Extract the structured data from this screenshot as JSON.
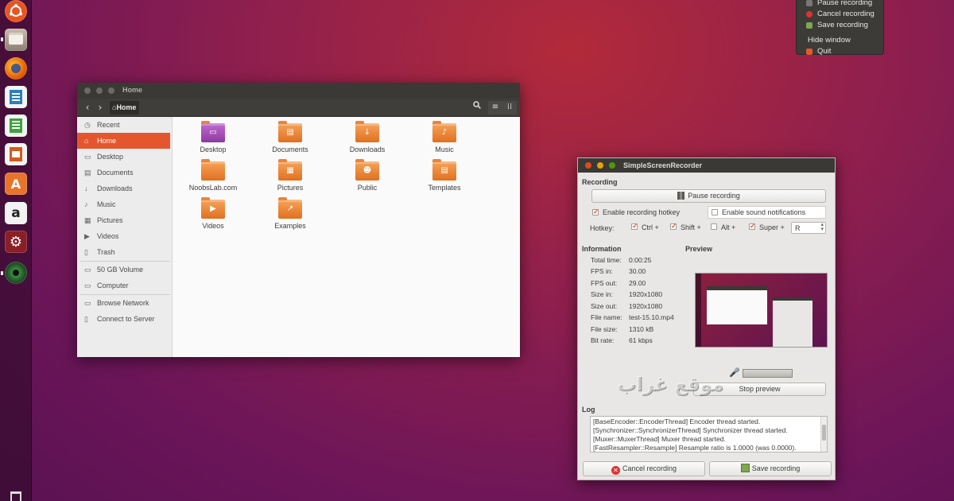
{
  "launcher": {
    "items": [
      {
        "name": "ubuntu-dash-icon",
        "color": "#e95420"
      },
      {
        "name": "files-icon",
        "color": "#9b8d7e"
      },
      {
        "name": "firefox-icon",
        "color": "#e66000"
      },
      {
        "name": "libreoffice-writer-icon",
        "color": "#2a7fbd"
      },
      {
        "name": "libreoffice-calc-icon",
        "color": "#3aa53a"
      },
      {
        "name": "libreoffice-impress-icon",
        "color": "#d55a1e"
      },
      {
        "name": "ubuntu-software-icon",
        "color": "#e8742a"
      },
      {
        "name": "amazon-icon",
        "color": "#f2f2f2"
      },
      {
        "name": "system-settings-icon",
        "color": "#c0392b"
      },
      {
        "name": "simplescreenrecorder-icon",
        "color": "#2f6f3a"
      },
      {
        "name": "trash-icon",
        "color": "#8c8c8c"
      }
    ]
  },
  "tray_menu": {
    "items": [
      "Pause recording",
      "Cancel recording",
      "Save recording",
      "Hide window",
      "Quit"
    ]
  },
  "nautilus": {
    "window_title": "Home",
    "breadcrumb": "Home",
    "sidebar": [
      {
        "label": "Recent",
        "icon": "clock-icon",
        "glyph": "◷"
      },
      {
        "label": "Home",
        "icon": "home-icon",
        "glyph": "⌂",
        "active": true
      },
      {
        "label": "Desktop",
        "icon": "desktop-icon",
        "glyph": "▭"
      },
      {
        "label": "Documents",
        "icon": "document-icon",
        "glyph": "▤"
      },
      {
        "label": "Downloads",
        "icon": "download-icon",
        "glyph": "↓"
      },
      {
        "label": "Music",
        "icon": "music-icon",
        "glyph": "♪"
      },
      {
        "label": "Pictures",
        "icon": "picture-icon",
        "glyph": "▦"
      },
      {
        "label": "Videos",
        "icon": "video-icon",
        "glyph": "▶"
      },
      {
        "label": "Trash",
        "icon": "trash-icon",
        "glyph": "▯"
      },
      {
        "label": "50 GB Volume",
        "icon": "drive-icon",
        "glyph": "▭"
      },
      {
        "label": "Computer",
        "icon": "computer-icon",
        "glyph": "▭"
      },
      {
        "label": "Browse Network",
        "icon": "network-icon",
        "glyph": "▭"
      },
      {
        "label": "Connect to Server",
        "icon": "server-icon",
        "glyph": "▯"
      }
    ],
    "folders": [
      {
        "label": "Desktop",
        "glyph": "▭",
        "color": "#9c4dab"
      },
      {
        "label": "Documents",
        "glyph": "▤",
        "color": "#e8742a"
      },
      {
        "label": "Downloads",
        "glyph": "↓",
        "color": "#e8742a"
      },
      {
        "label": "Music",
        "glyph": "♪",
        "color": "#e8742a"
      },
      {
        "label": "NoobsLab.com",
        "glyph": "",
        "color": "#e8742a"
      },
      {
        "label": "Pictures",
        "glyph": "▦",
        "color": "#e8742a"
      },
      {
        "label": "Public",
        "glyph": "☻",
        "color": "#e8742a"
      },
      {
        "label": "Templates",
        "glyph": "▤",
        "color": "#e8742a"
      },
      {
        "label": "Videos",
        "glyph": "▶",
        "color": "#e8742a"
      },
      {
        "label": "Examples",
        "glyph": "↗",
        "color": "#e8742a"
      }
    ]
  },
  "ssr": {
    "window_title": "SimpleScreenRecorder",
    "recording_heading": "Recording",
    "pause_button": "Pause recording",
    "enable_hotkey": "Enable recording hotkey",
    "enable_sound": "Enable sound notifications",
    "hotkey_label": "Hotkey:",
    "mod_ctrl": "Ctrl +",
    "mod_shift": "Shift +",
    "mod_alt": "Alt +",
    "mod_super": "Super +",
    "hotkey_key": "R",
    "information_heading": "Information",
    "preview_heading": "Preview",
    "info": [
      {
        "key": "Total time:",
        "value": "0:00:25"
      },
      {
        "key": "FPS in:",
        "value": "30.00"
      },
      {
        "key": "FPS out:",
        "value": "29.00"
      },
      {
        "key": "Size in:",
        "value": "1920x1080"
      },
      {
        "key": "Size out:",
        "value": "1920x1080"
      },
      {
        "key": "File name:",
        "value": "test-15.10.mp4"
      },
      {
        "key": "File size:",
        "value": "1310 kB"
      },
      {
        "key": "Bit rate:",
        "value": "61 kbps"
      }
    ],
    "stop_preview": "Stop preview",
    "log_heading": "Log",
    "log_lines": [
      "[BaseEncoder::EncoderThread] Encoder thread started.",
      "[Synchronizer::SynchronizerThread] Synchronizer thread started.",
      "[Muxer::MuxerThread] Muxer thread started.",
      "[FastResampler::Resample] Resample ratio is 1.0000 (was 0.0000)."
    ],
    "cancel_button": "Cancel recording",
    "save_button": "Save recording"
  },
  "watermark": "موقع غراب",
  "colors": {
    "accent": "#e4572e",
    "titlebar": "#3a3935",
    "close": "#df4a16",
    "minimize": "#e8a200",
    "maximize": "#4e9a06"
  }
}
